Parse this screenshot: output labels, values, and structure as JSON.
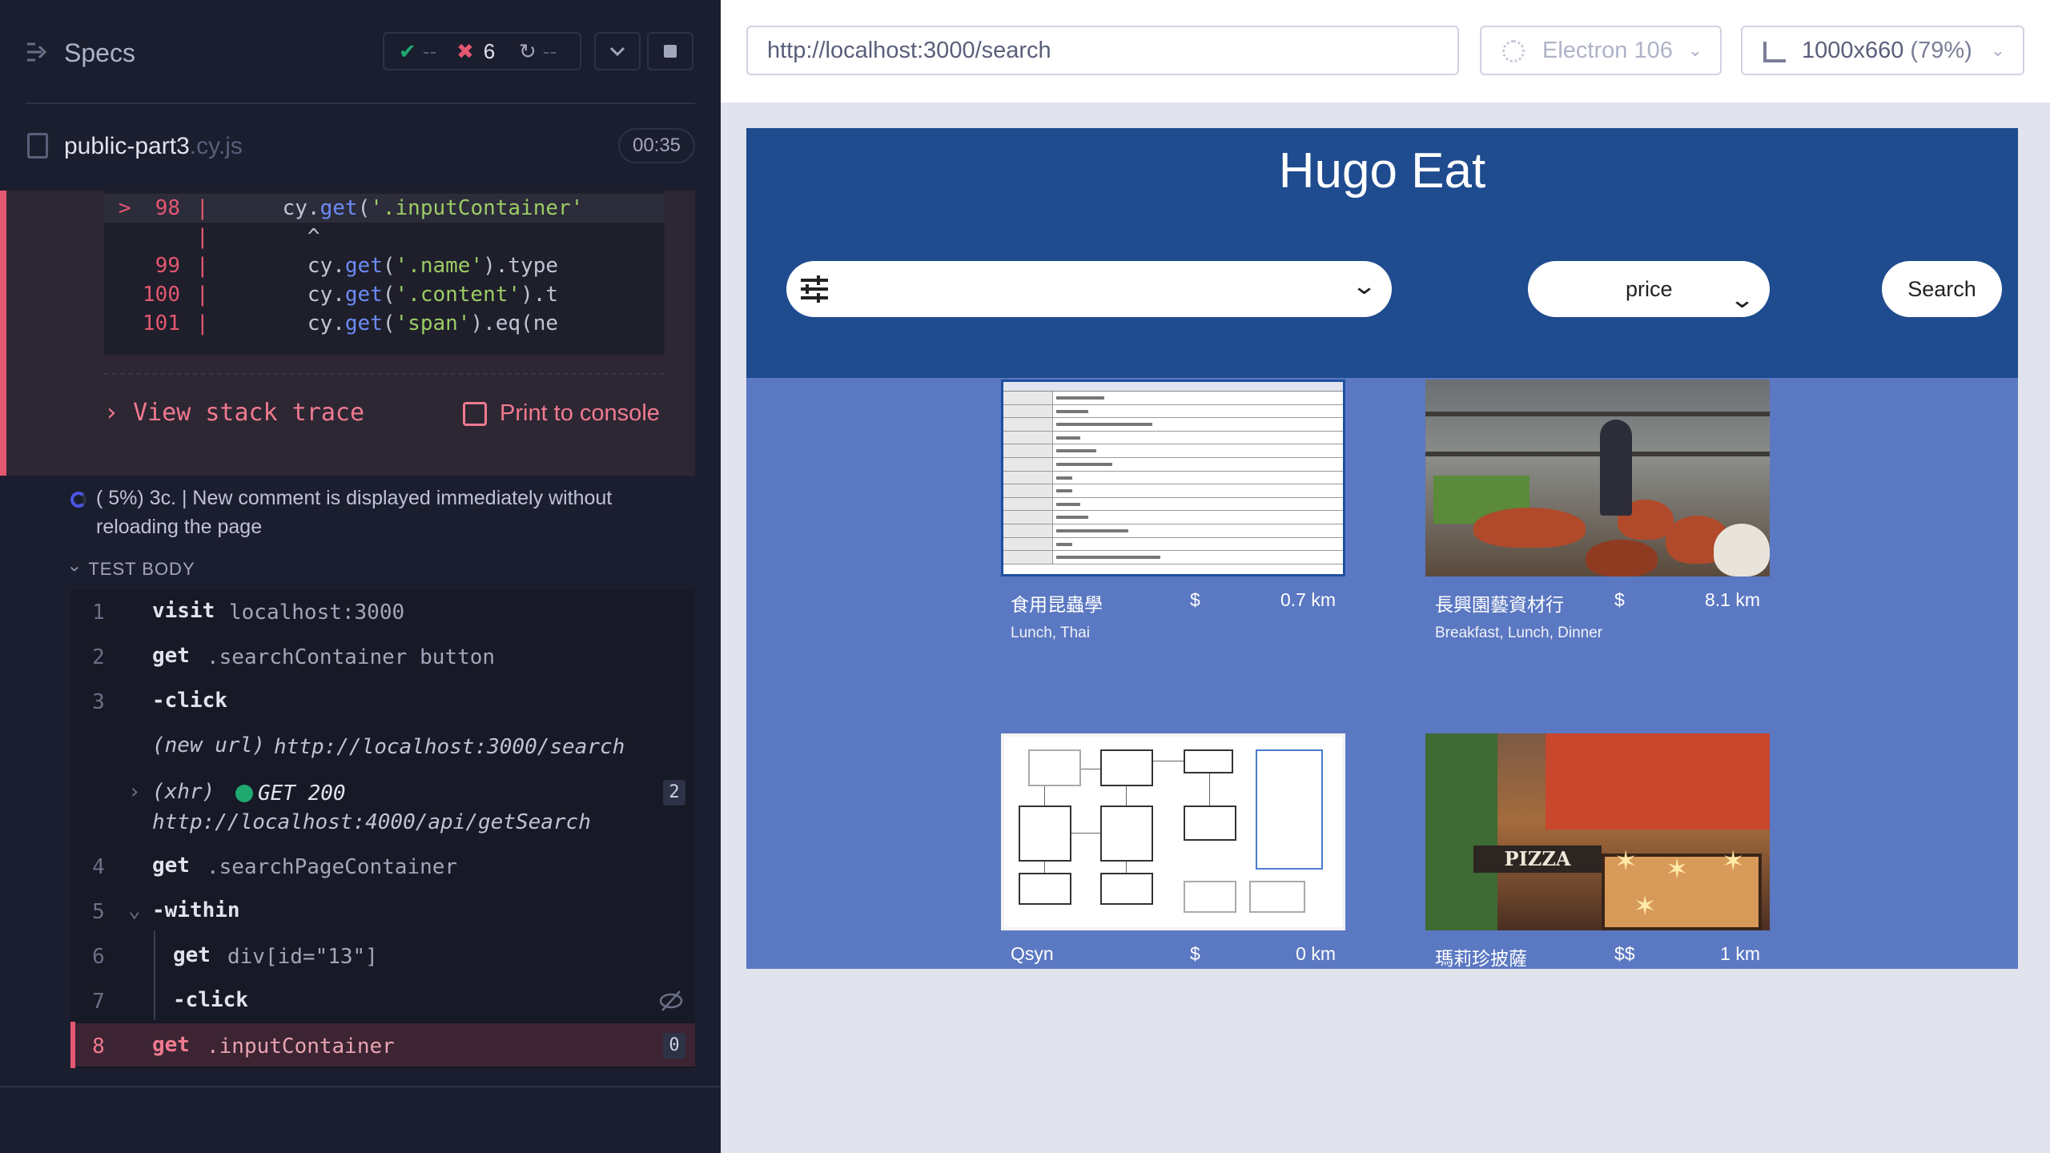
{
  "reporter": {
    "header": {
      "title": "Specs",
      "passed": "--",
      "failed": "6",
      "pending": "--"
    },
    "spec_file": {
      "name": "public-part3",
      "ext": ".cy.js",
      "duration": "00:35"
    },
    "code_frame": {
      "lines": [
        {
          "arrow": ">",
          "num": "98",
          "indent": "    ",
          "pre": "cy.",
          "fn": "get",
          "open": "(",
          "str": "'.inputContainer'",
          "rest": ""
        },
        {
          "arrow": "",
          "num": "",
          "indent": "",
          "pre": "",
          "fn": "",
          "open": "",
          "str": "",
          "rest": "      ^"
        },
        {
          "arrow": "",
          "num": "99",
          "indent": "      ",
          "pre": "cy.",
          "fn": "get",
          "open": "(",
          "str": "'.name'",
          "rest": ").type"
        },
        {
          "arrow": "",
          "num": "100",
          "indent": "      ",
          "pre": "cy.",
          "fn": "get",
          "open": "(",
          "str": "'.content'",
          "rest": ").t"
        },
        {
          "arrow": "",
          "num": "101",
          "indent": "      ",
          "pre": "cy.",
          "fn": "get",
          "open": "(",
          "str": "'span'",
          "rest": ").eq(ne"
        }
      ]
    },
    "view_stack_trace": "View stack trace",
    "print_to_console": "Print to console",
    "test_title": "( 5%) 3c. | New comment is displayed immediately without reloading the page",
    "test_body_label": "TEST BODY",
    "commands": [
      {
        "num": "1",
        "name": "visit",
        "msg": "localhost:3000"
      },
      {
        "num": "2",
        "name": "get",
        "msg": ".searchContainer button"
      },
      {
        "num": "3",
        "name": "-click",
        "msg": ""
      },
      {
        "num": "",
        "name": "(new url)",
        "msg": "http://localhost:3000/search"
      },
      {
        "num": "",
        "name": "(xhr)",
        "msg": "GET 200",
        "msg2": "http://localhost:4000/api/getSearch",
        "badge": "2"
      },
      {
        "num": "4",
        "name": "get",
        "msg": ".searchPageContainer"
      },
      {
        "num": "5",
        "name": "-within",
        "msg": ""
      },
      {
        "num": "6",
        "name": "get",
        "msg": "div[id=\"13\"]"
      },
      {
        "num": "7",
        "name": "-click",
        "msg": ""
      },
      {
        "num": "8",
        "name": "get",
        "msg": ".inputContainer",
        "badge": "0"
      }
    ]
  },
  "aut": {
    "url": "http://localhost:3000/search",
    "browser": "Electron 106",
    "viewport": "1000x660",
    "zoom": "(79%)",
    "app": {
      "title": "Hugo Eat",
      "price_select": "price",
      "search_button": "Search",
      "restaurants": [
        {
          "name": "食用昆蟲學",
          "price": "$",
          "distance": "0.7 km",
          "tags": "Lunch, Thai"
        },
        {
          "name": "長興園藝資材行",
          "price": "$",
          "distance": "8.1 km",
          "tags": "Breakfast, Lunch, Dinner"
        },
        {
          "name": "Qsyn",
          "price": "$",
          "distance": "0 km",
          "tags": ""
        },
        {
          "name": "瑪莉珍披薩",
          "price": "$$",
          "distance": "1 km",
          "tags": ""
        }
      ],
      "pizza_sign": "PIZZA"
    }
  },
  "colors": {
    "reporter_bg": "#1b1e2e",
    "fail": "#e45770",
    "pass": "#1fa971",
    "app_header": "#1f4b8f",
    "app_body": "#5b78c2"
  }
}
